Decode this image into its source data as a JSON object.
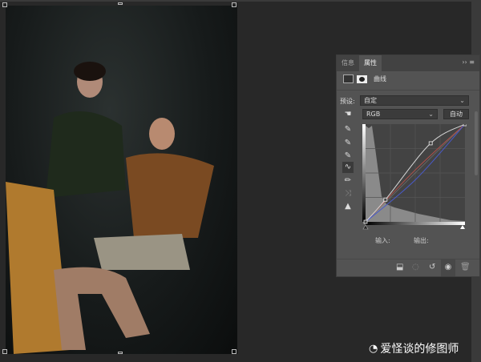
{
  "panel": {
    "tabs": [
      {
        "label": "信息"
      },
      {
        "label": "属性"
      }
    ],
    "menu_icon": "collapse-menu-icon",
    "adjustment_title": "曲线",
    "preset_label": "预设:",
    "preset_value": "自定",
    "channel_value": "RGB",
    "auto_label": "自动",
    "input_label": "输入:",
    "output_label": "输出:"
  },
  "curves": {
    "rgb_points": [
      [
        0,
        0
      ],
      [
        51,
        58
      ],
      [
        167,
        205
      ],
      [
        255,
        255
      ]
    ],
    "red_points": [
      [
        0,
        0
      ],
      [
        128,
        136
      ],
      [
        255,
        255
      ]
    ],
    "blue_points": [
      [
        0,
        0
      ],
      [
        128,
        110
      ],
      [
        255,
        255
      ]
    ],
    "colors": {
      "rgb": "#d8d8d8",
      "red": "#b0504a",
      "blue": "#4a5ac8"
    }
  },
  "watermark": "爱怪谈的修图师"
}
